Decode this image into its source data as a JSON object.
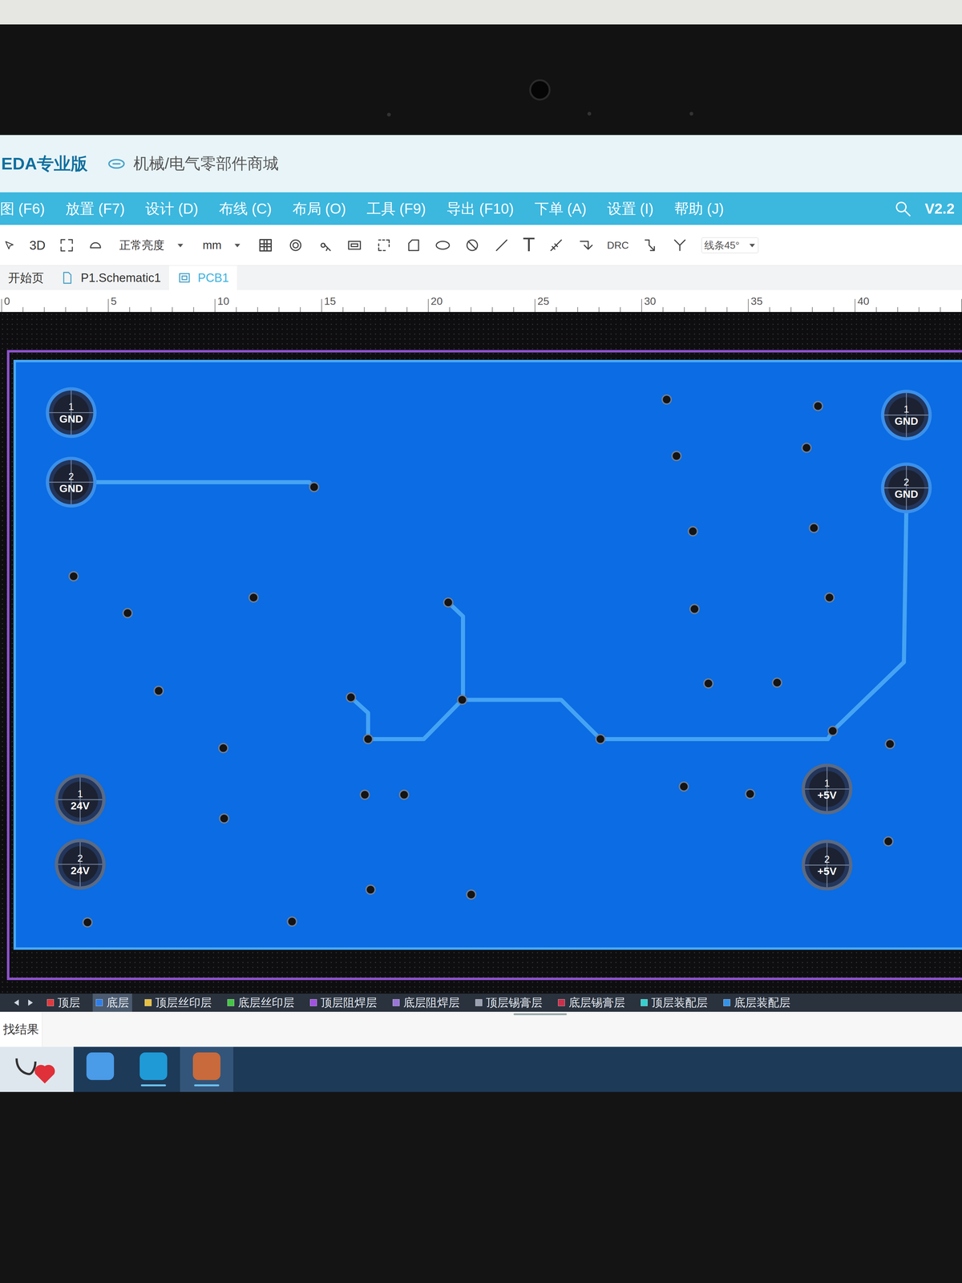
{
  "window": {
    "title": "EDA专业版",
    "link": "机械/电气零部件商城"
  },
  "menu": [
    "图 (F6)",
    "放置 (F7)",
    "设计 (D)",
    "布线 (C)",
    "布局 (O)",
    "工具 (F9)",
    "导出 (F10)",
    "下单 (A)",
    "设置 (I)",
    "帮助 (J)"
  ],
  "version": "V2.2",
  "toolbar": {
    "view_3d": "3D",
    "brightness": "正常亮度",
    "unit": "mm",
    "text_tool": "T",
    "drc": "DRC",
    "line_mode": "线条45°"
  },
  "tabs": [
    {
      "label": "开始页",
      "selected": false
    },
    {
      "label": "P1.Schematic1",
      "selected": false
    },
    {
      "label": "PCB1",
      "selected": true
    }
  ],
  "ruler": [
    "0",
    "5",
    "10",
    "15",
    "20",
    "25",
    "30",
    "35",
    "40"
  ],
  "pads": [
    {
      "number": "1",
      "net": "GND"
    },
    {
      "number": "2",
      "net": "GND"
    },
    {
      "number": "1",
      "net": "GND"
    },
    {
      "number": "2",
      "net": "GND"
    },
    {
      "number": "1",
      "net": "24V"
    },
    {
      "number": "2",
      "net": "24V"
    },
    {
      "number": "1",
      "net": "+5V"
    },
    {
      "number": "2",
      "net": "+5V"
    }
  ],
  "layers": [
    {
      "label": "顶层",
      "color": "#e0393e",
      "selected": false
    },
    {
      "label": "底层",
      "color": "#2f7ee6",
      "selected": true
    },
    {
      "label": "顶层丝印层",
      "color": "#e8c040",
      "selected": false
    },
    {
      "label": "底层丝印层",
      "color": "#46c446",
      "selected": false
    },
    {
      "label": "顶层阻焊层",
      "color": "#a052e0",
      "selected": false
    },
    {
      "label": "底层阻焊层",
      "color": "#9a74d8",
      "selected": false
    },
    {
      "label": "顶层锡膏层",
      "color": "#9aa0b0",
      "selected": false
    },
    {
      "label": "底层锡膏层",
      "color": "#c8304a",
      "selected": false
    },
    {
      "label": "顶层装配层",
      "color": "#34d0d0",
      "selected": false
    },
    {
      "label": "底层装配层",
      "color": "#3592e6",
      "selected": false
    }
  ],
  "panel": {
    "title": "找结果"
  }
}
